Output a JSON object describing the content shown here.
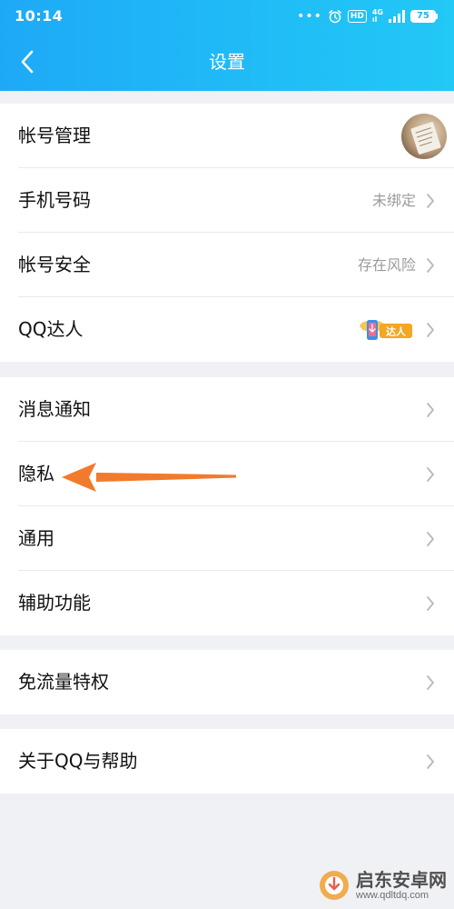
{
  "status_bar": {
    "time": "10:14",
    "hd": "HD",
    "network_top": "4G",
    "network_bottom": "ıl",
    "battery": "75"
  },
  "nav": {
    "title": "设置",
    "back_icon": "chevron-left-icon"
  },
  "groups": [
    {
      "rows": [
        {
          "label": "帐号管理",
          "trailing": "avatar"
        },
        {
          "label": "手机号码",
          "value": "未绑定"
        },
        {
          "label": "帐号安全",
          "value": "存在风险"
        },
        {
          "label": "QQ达人",
          "badge": "达人"
        }
      ]
    },
    {
      "rows": [
        {
          "label": "消息通知"
        },
        {
          "label": "隐私"
        },
        {
          "label": "通用"
        },
        {
          "label": "辅助功能"
        }
      ]
    },
    {
      "rows": [
        {
          "label": "免流量特权"
        }
      ]
    },
    {
      "rows": [
        {
          "label": "关于QQ与帮助"
        }
      ]
    }
  ],
  "watermark": {
    "name": "启东安卓网",
    "url": "www.qdltdq.com"
  },
  "colors": {
    "header_start": "#1ea9f7",
    "header_end": "#22c8f6",
    "page_bg": "#f0f1f5",
    "annotation_arrow": "#f27a2c"
  }
}
